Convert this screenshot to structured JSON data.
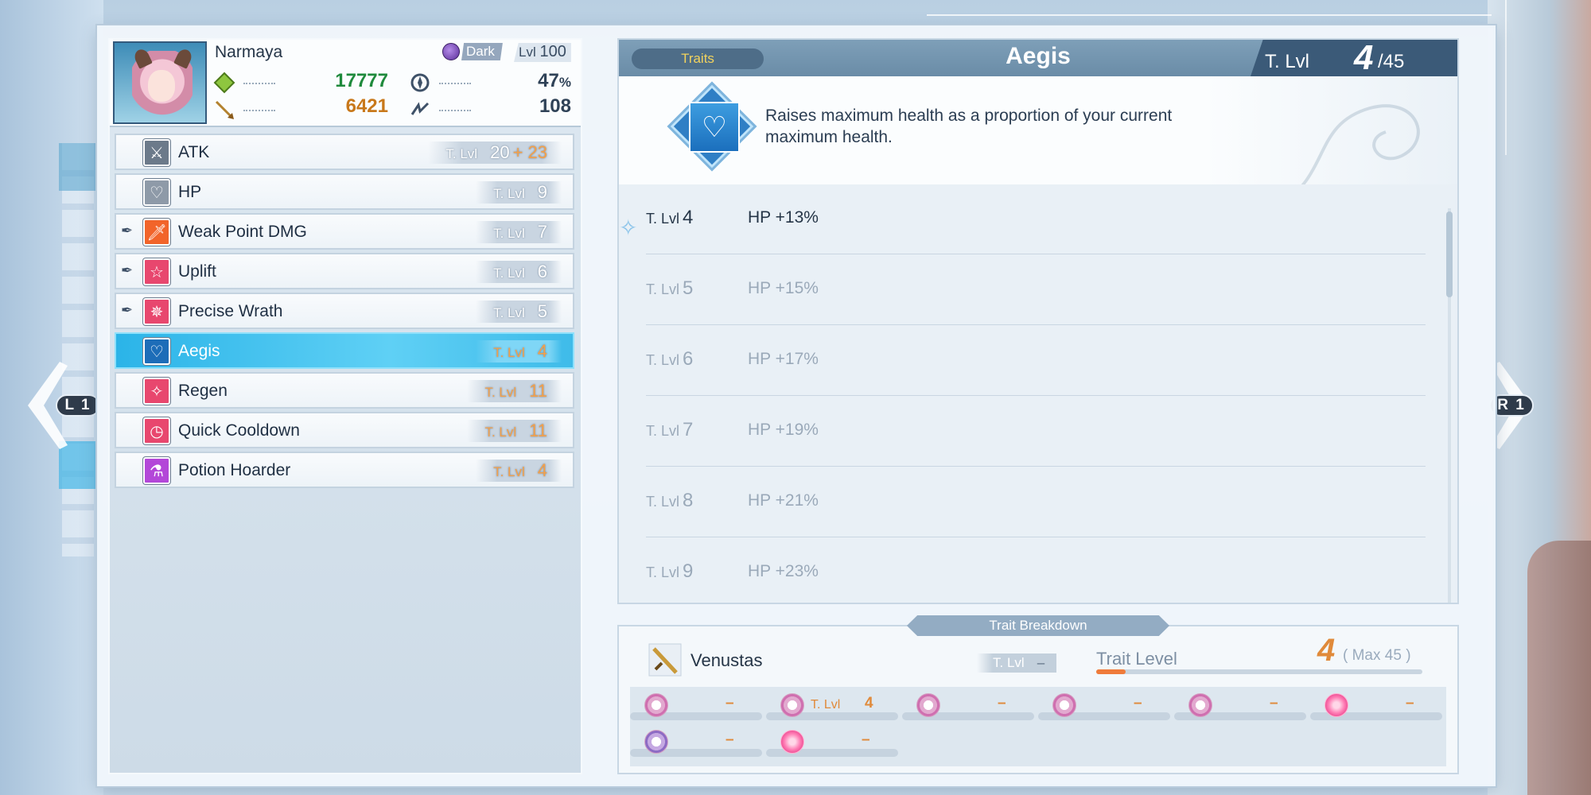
{
  "character": {
    "name": "Narmaya",
    "element": "Dark",
    "level_label": "Lvl",
    "level": "100",
    "hp": "17777",
    "atk": "6421",
    "crit_rate": "47",
    "crit_unit": "%",
    "stun": "108"
  },
  "traits": [
    {
      "name": "ATK",
      "tlvl_label": "T. Lvl",
      "value": "20",
      "bonus": "+ 23",
      "icon": "sword-icon",
      "color": "#6c7a8a",
      "pinned": false
    },
    {
      "name": "HP",
      "tlvl_label": "T. Lvl",
      "value": "9",
      "icon": "heart-icon",
      "color": "#8e9aa8",
      "pinned": false
    },
    {
      "name": "Weak Point DMG",
      "tlvl_label": "T. Lvl",
      "value": "7",
      "icon": "blade-icon",
      "color": "#f2642a",
      "pinned": true
    },
    {
      "name": "Uplift",
      "tlvl_label": "T. Lvl",
      "value": "6",
      "icon": "star-icon",
      "color": "#e8476e",
      "pinned": true
    },
    {
      "name": "Precise Wrath",
      "tlvl_label": "T. Lvl",
      "value": "5",
      "icon": "burst-icon",
      "color": "#e8476e",
      "pinned": true
    },
    {
      "name": "Aegis",
      "tlvl_label": "T. Lvl",
      "value": "4",
      "icon": "heart-icon",
      "color": "#1d6db8",
      "pinned": false,
      "selected": true
    },
    {
      "name": "Regen",
      "tlvl_label": "T. Lvl",
      "value": "11",
      "icon": "sparkle-icon",
      "color": "#e8476e",
      "pinned": false
    },
    {
      "name": "Quick Cooldown",
      "tlvl_label": "T. Lvl",
      "value": "11",
      "icon": "clock-icon",
      "color": "#e8476e",
      "pinned": false
    },
    {
      "name": "Potion Hoarder",
      "tlvl_label": "T. Lvl",
      "value": "4",
      "icon": "potion-icon",
      "color": "#b347d8",
      "pinned": false
    }
  ],
  "detail": {
    "tab": "Traits",
    "title": "Aegis",
    "tlvl_label": "T. Lvl",
    "current": "4",
    "max": "/45",
    "description": "Raises maximum health as a proportion of your current maximum health.",
    "levels": [
      {
        "label": "T. Lvl",
        "level": "4",
        "effect": "HP +13%",
        "current": true
      },
      {
        "label": "T. Lvl",
        "level": "5",
        "effect": "HP +15%"
      },
      {
        "label": "T. Lvl",
        "level": "6",
        "effect": "HP +17%"
      },
      {
        "label": "T. Lvl",
        "level": "7",
        "effect": "HP +19%"
      },
      {
        "label": "T. Lvl",
        "level": "8",
        "effect": "HP +21%"
      },
      {
        "label": "T. Lvl",
        "level": "9",
        "effect": "HP +23%"
      }
    ]
  },
  "breakdown": {
    "title": "Trait Breakdown",
    "weapon": "Venustas",
    "tlvl_label": "T. Lvl",
    "tlvl_value": "–",
    "trait_level_label": "Trait Level",
    "level": "4",
    "max_text": "( Max 45 )",
    "progress_fraction": 0.09,
    "slots": [
      {
        "label": "",
        "value": "–",
        "icon": "pink"
      },
      {
        "label": "T. Lvl",
        "value": "4",
        "icon": "pink"
      },
      {
        "label": "",
        "value": "–",
        "icon": "pink"
      },
      {
        "label": "",
        "value": "–",
        "icon": "pink"
      },
      {
        "label": "",
        "value": "–",
        "icon": "pink"
      },
      {
        "label": "",
        "value": "–",
        "icon": "burst"
      },
      {
        "label": "",
        "value": "–",
        "icon": "violet"
      },
      {
        "label": "",
        "value": "–",
        "icon": "burst"
      }
    ]
  },
  "nav": {
    "left_key": "L 1",
    "right_key": "R 1"
  }
}
